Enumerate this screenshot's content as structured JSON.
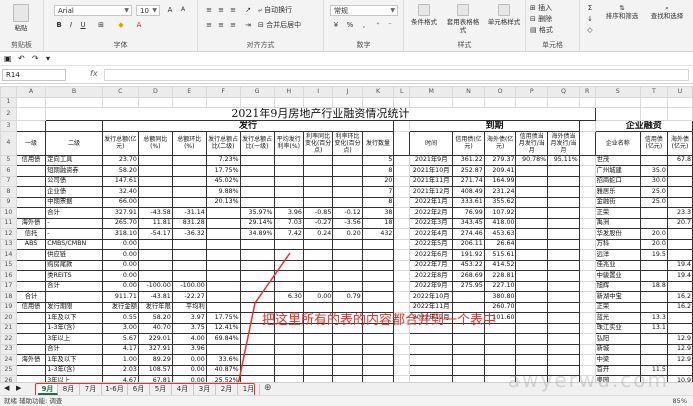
{
  "ribbon": {
    "paste": "粘贴",
    "clipboard": "剪贴板",
    "font_name": "Arial",
    "font_size": "10",
    "font_group": "字体",
    "wrap": "自动换行",
    "merge": "合并后居中",
    "align_group": "对齐方式",
    "numfmt": "常规",
    "number_group": "数字",
    "cond": "条件格式",
    "table_fmt": "套用表格格式",
    "cell_style": "单元格样式",
    "style_group": "样式",
    "insert": "插入",
    "delete": "删除",
    "format": "格式",
    "cells_group": "单元格",
    "sort": "排序和筛选",
    "find": "查找和选择"
  },
  "namebox": "R14",
  "fx": "fx",
  "cols": [
    "A",
    "B",
    "C",
    "D",
    "E",
    "F",
    "G",
    "H",
    "I",
    "J",
    "K",
    "L",
    "M",
    "N",
    "O",
    "P",
    "Q",
    "R",
    "S",
    "T",
    "U"
  ],
  "sheet": {
    "title": "2021年9月房地产行业融资情况统计",
    "issue": "发行",
    "maturity": "到期",
    "corp": "企业融资",
    "hdr": [
      "一级",
      "二级",
      "发行总额(亿元)",
      "总额同比(%)",
      "总额环比(%)",
      "发行总额占比(二级)",
      "发行总额占比(一级)",
      "平均发行利率(%)",
      "利率同比变化(百分点)",
      "利率环比变化(百分点)",
      "发行数量",
      "",
      "时间",
      "信用债(亿元)",
      "海外债(亿元)",
      "信用债当月发行/当月",
      "海外债当月发行/当月",
      "",
      "企业名称",
      "信用债(亿元)",
      "海外债(亿元)"
    ],
    "rows": [
      [
        "信用债",
        "定向工具",
        "23.70",
        "",
        "",
        "7.23%",
        "",
        "",
        "",
        "",
        "5",
        "",
        "2021年9月",
        "361.22",
        "279.37",
        "90.78%",
        "95.11%",
        "",
        "世茂",
        "",
        "67.8"
      ],
      [
        "",
        "短期融资券",
        "58.20",
        "",
        "",
        "17.75%",
        "",
        "",
        "",
        "",
        "8",
        "",
        "2021年10月",
        "252.87",
        "209.41",
        "",
        "",
        "",
        "广州城建",
        "35.0",
        ""
      ],
      [
        "",
        "公司债",
        "147.61",
        "",
        "",
        "45.02%",
        "",
        "",
        "",
        "",
        "20",
        "",
        "2021年11月",
        "271.74",
        "164.99",
        "",
        "",
        "",
        "招商蛇口",
        "30.0",
        ""
      ],
      [
        "",
        "企业债",
        "32.40",
        "",
        "",
        "9.88%",
        "",
        "",
        "",
        "",
        "7",
        "",
        "2021年12月",
        "408.49",
        "231.24",
        "",
        "",
        "",
        "雅居乐",
        "25.0",
        ""
      ],
      [
        "",
        "中期票据",
        "66.00",
        "",
        "",
        "20.13%",
        "",
        "",
        "",
        "",
        "8",
        "",
        "2022年1月",
        "333.61",
        "355.62",
        "",
        "",
        "",
        "金融街",
        "25.0",
        ""
      ],
      [
        "",
        "合计",
        "327.91",
        "-43.58",
        "-31.14",
        "",
        "35.97%",
        "3.96",
        "-0.85",
        "-0.12",
        "38",
        "",
        "2022年2月",
        "76.99",
        "107.92",
        "",
        "",
        "",
        "正荣",
        "",
        "23.3"
      ],
      [
        "海外债",
        "-",
        "265.70",
        "11.81",
        "831.28",
        "",
        "29.14%",
        "7.03",
        "-0.27",
        "-3.56",
        "18",
        "",
        "2022年3月",
        "343.45",
        "418.00",
        "",
        "",
        "",
        "禹洲",
        "",
        "20.7"
      ],
      [
        "信托",
        "-",
        "318.10",
        "-54.17",
        "-36.32",
        "",
        "34.89%",
        "7.42",
        "0.24",
        "0.20",
        "432",
        "",
        "2022年4月",
        "274.46",
        "453.63",
        "",
        "",
        "",
        "华发股份",
        "20.0",
        ""
      ],
      [
        "ABS",
        "CMBS/CMBN",
        "0.00",
        "",
        "",
        "",
        "",
        "",
        "",
        "",
        "",
        "",
        "2022年5月",
        "206.11",
        "26.64",
        "",
        "",
        "",
        "万科",
        "20.0",
        ""
      ],
      [
        "",
        "供应链",
        "0.00",
        "",
        "",
        "",
        "",
        "",
        "",
        "",
        "",
        "",
        "2022年6月",
        "191.92",
        "515.61",
        "",
        "",
        "",
        "远洋",
        "19.5",
        ""
      ],
      [
        "",
        "购房尾款",
        "0.00",
        "",
        "",
        "",
        "",
        "",
        "",
        "",
        "",
        "",
        "2022年7月",
        "453.22",
        "414.52",
        "",
        "",
        "",
        "佳兆业",
        "",
        "19.4"
      ],
      [
        "",
        "类REITS",
        "0.00",
        "",
        "",
        "",
        "",
        "",
        "",
        "",
        "",
        "",
        "2022年8月",
        "268.69",
        "228.81",
        "",
        "",
        "",
        "中骏置业",
        "",
        "19.4"
      ],
      [
        "",
        "合计",
        "0.00",
        "-100.00",
        "-100.00",
        "",
        "",
        "",
        "",
        "",
        "",
        "",
        "2022年9月",
        "275.95",
        "227.10",
        "",
        "",
        "",
        "旭辉",
        "18.8",
        ""
      ],
      [
        "合计",
        "",
        "911.71",
        "-43.81",
        "-22.27",
        "",
        "",
        "6.30",
        "0.00",
        "0.79",
        "",
        "",
        "2022年10月",
        "",
        "380.80",
        "",
        "",
        "",
        "新湖中宝",
        "",
        "16.2"
      ],
      [
        "信用债",
        "发行期限",
        "发行金额",
        "发行年限",
        "平均利",
        "",
        "",
        "",
        "",
        "",
        "",
        "",
        "2022年11月",
        "",
        "260.70",
        "",
        "",
        "",
        "正荣",
        "",
        "16.2"
      ],
      [
        "",
        "1年及以下",
        "0.55",
        "58.20",
        "3.97",
        "17.75%",
        "",
        "",
        "",
        "",
        "",
        "",
        "2022年12月",
        "",
        "101.60",
        "",
        "",
        "",
        "蓝光",
        "13.3",
        ""
      ],
      [
        "",
        "1-3年(含)",
        "3.00",
        "40.70",
        "3.75",
        "12.41%",
        "",
        "",
        "",
        "",
        "",
        "",
        "",
        "",
        "",
        "",
        "",
        "",
        "珠江实业",
        "13.1",
        ""
      ],
      [
        "",
        "3年以上",
        "5.67",
        "229.01",
        "4.00",
        "69.84%",
        "",
        "",
        "",
        "",
        "",
        "",
        "",
        "",
        "",
        "",
        "",
        "",
        "弘阳",
        "",
        "12.9"
      ],
      [
        "",
        "合计",
        "4.17",
        "327.91",
        "3.96",
        "",
        "",
        "",
        "",
        "",
        "",
        "",
        "",
        "",
        "",
        "",
        "",
        "",
        "新城",
        "",
        "12.9"
      ],
      [
        "海外债",
        "1年及以下",
        "1.00",
        "89.29",
        "0.00",
        "33.6%",
        "",
        "",
        "",
        "",
        "",
        "",
        "",
        "",
        "",
        "",
        "",
        "",
        "中梁",
        "",
        "12.9"
      ],
      [
        "",
        "1-3年(含)",
        "2.03",
        "108.57",
        "0.00",
        "40.87%",
        "",
        "",
        "",
        "",
        "",
        "",
        "",
        "",
        "",
        "",
        "",
        "",
        "首开",
        "11.5",
        ""
      ],
      [
        "",
        "3年以上",
        "4.67",
        "67.81",
        "0.00",
        "25.52%",
        "",
        "",
        "",
        "",
        "",
        "",
        "",
        "",
        "",
        "",
        "",
        "",
        "奥园",
        "",
        "10.9"
      ],
      [
        "",
        "合计",
        "1.98",
        "265.00",
        "0.00",
        "",
        "",
        "",
        "",
        "",
        "",
        "",
        "",
        "",
        "",
        "",
        "",
        "",
        "金科",
        "10.0",
        ""
      ],
      [
        "",
        "",
        "",
        "",
        "",
        "",
        "",
        "",
        "",
        "",
        "",
        "",
        "",
        "",
        "",
        "",
        "",
        "",
        "阳光城",
        "",
        "9.0"
      ]
    ]
  },
  "annotation": "把这里所有的表的内容都合并到一个表中",
  "tabs": [
    "9月",
    "8月",
    "7月",
    "1-6月",
    "6月",
    "5月",
    "4月",
    "3月",
    "2月",
    "1月"
  ],
  "status": "就绪  辅助功能: 调查",
  "zoom": "85%",
  "watermark": "awyerwu.com"
}
